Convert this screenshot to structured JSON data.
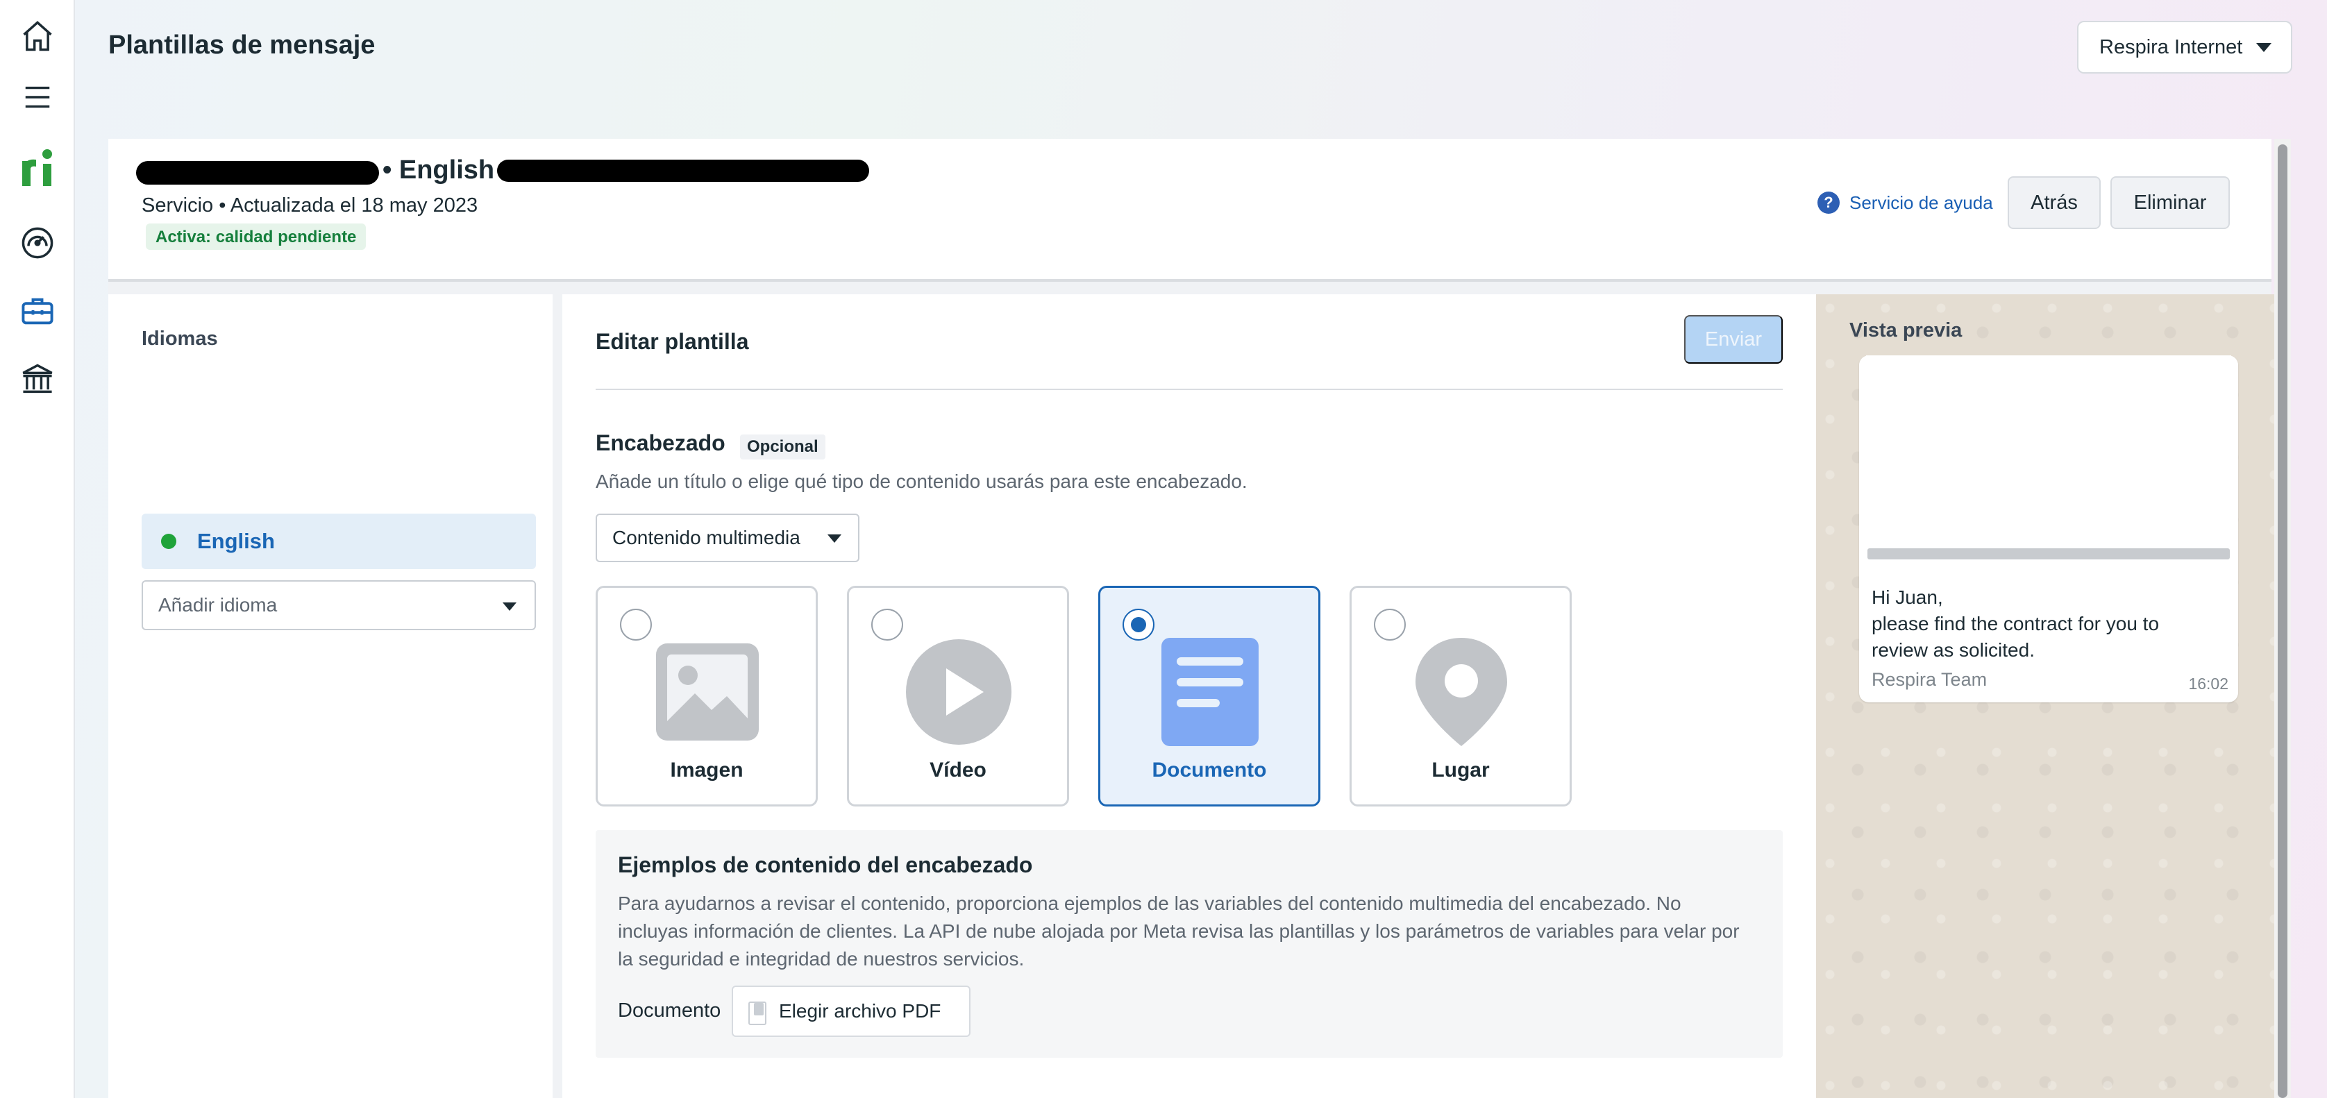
{
  "page": {
    "title": "Plantillas de mensaje",
    "account": "Respira Internet"
  },
  "template": {
    "name_visible": "• English •",
    "meta": "Servicio • Actualizada el 18 may 2023",
    "status": "Activa: calidad pendiente",
    "help_link": "Servicio de ayuda",
    "back_button": "Atrás",
    "delete_button": "Eliminar"
  },
  "languages": {
    "title": "Idiomas",
    "active": "English",
    "add_placeholder": "Añadir idioma"
  },
  "editor": {
    "title": "Editar plantilla",
    "send_button": "Enviar",
    "header_title": "Encabezado",
    "optional_badge": "Opcional",
    "header_desc": "Añade un título o elige qué tipo de contenido usarás para este encabezado.",
    "media_select": "Contenido multimedia",
    "options": [
      {
        "label": "Imagen",
        "icon": "image-icon",
        "selected": false
      },
      {
        "label": "Vídeo",
        "icon": "video-play-icon",
        "selected": false
      },
      {
        "label": "Documento",
        "icon": "document-icon",
        "selected": true
      },
      {
        "label": "Lugar",
        "icon": "location-pin-icon",
        "selected": false
      }
    ],
    "examples_title": "Ejemplos de contenido del encabezado",
    "examples_desc": "Para ayudarnos a revisar el contenido, proporciona ejemplos de las variables del contenido multimedia del encabezado. No incluyas información de clientes. La API de nube alojada por Meta revisa las plantillas y los parámetros de variables para velar por la seguridad e integridad de nuestros servicios.",
    "document_label": "Documento",
    "choose_pdf": "Elegir archivo PDF"
  },
  "preview": {
    "title": "Vista previa",
    "message_lines": [
      "Hi Juan,",
      "please find the contract for you to",
      "review as solicited."
    ],
    "footer": "Respira Team",
    "time": "16:02"
  },
  "colors": {
    "accent": "#1a66b5",
    "status_green": "#157f3c",
    "active_dot": "#1fa33a",
    "brand_green": "#2e9e3e"
  }
}
